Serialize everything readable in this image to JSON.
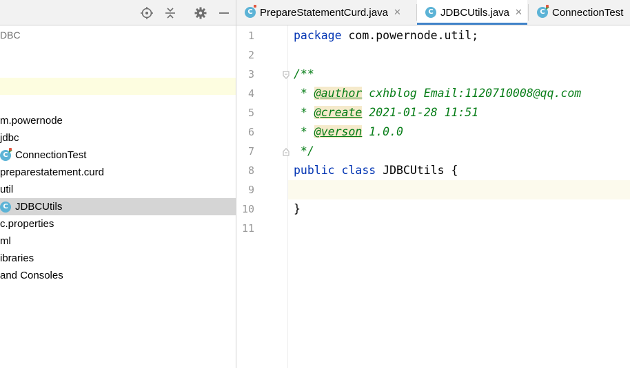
{
  "project": {
    "items": [
      {
        "label": "DBC"
      },
      {
        "label": ""
      },
      {
        "label": ""
      },
      {
        "label": ""
      },
      {
        "label": "m.powernode"
      },
      {
        "label": "jdbc"
      },
      {
        "label": "ConnectionTest"
      },
      {
        "label": "preparestatement.curd"
      },
      {
        "label": "util"
      },
      {
        "label": "JDBCUtils"
      },
      {
        "label": "c.properties"
      },
      {
        "label": "ml"
      },
      {
        "label": "ibraries"
      },
      {
        "label": " and Consoles"
      }
    ],
    "class_icon_letter": "C"
  },
  "tabs": [
    {
      "label": "PrepareStatementCurd.java",
      "close": "✕"
    },
    {
      "label": "JDBCUtils.java",
      "close": "✕"
    },
    {
      "label": "ConnectionTest",
      "close": ""
    }
  ],
  "editor": {
    "line_numbers": [
      "1",
      "2",
      "3",
      "4",
      "5",
      "6",
      "7",
      "8",
      "9",
      "10",
      "11"
    ],
    "code": {
      "l1_kw": "package",
      "l1_rest": " com.powernode.util;",
      "l3": "/**",
      "l4_star": " * ",
      "l4_tag": "@author",
      "l4_rest": " cxhblog Email:1120710008@qq.com",
      "l5_star": " * ",
      "l5_tag": "@create",
      "l5_rest": " 2021-01-28 11:51",
      "l6_star": " * ",
      "l6_tag": "@verson",
      "l6_rest": " 1.0.0",
      "l7": " */",
      "l8_kw1": "public",
      "l8_kw2": "class",
      "l8_name": "JDBCUtils",
      "l8_brace": "{",
      "l10": "}"
    },
    "current_line": "9"
  },
  "colors": {
    "keyword": "#0033b3",
    "doc_comment": "#067d17",
    "selection": "#d5d5d5",
    "tab_underline": "#4083c9"
  }
}
